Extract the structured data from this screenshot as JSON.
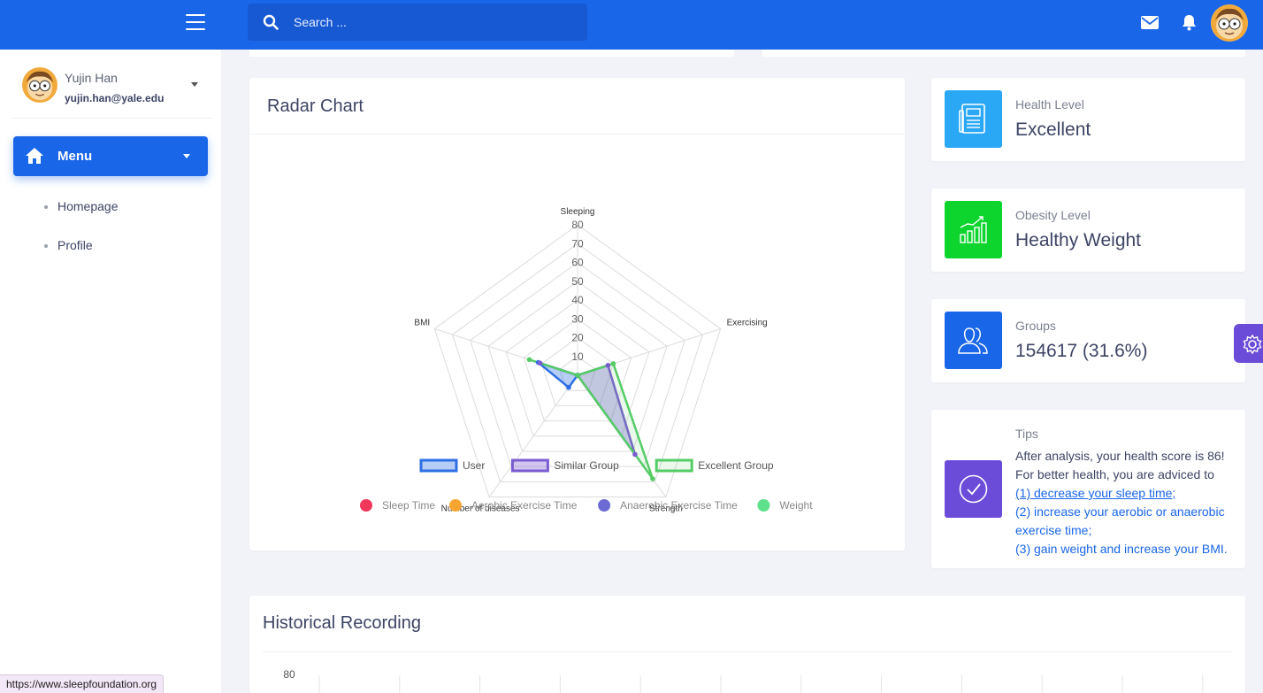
{
  "header": {
    "search_placeholder": "Search ...",
    "icons": [
      "menu-icon",
      "search-icon",
      "mail-icon",
      "bell-icon",
      "avatar"
    ],
    "accent": "#1a66e8"
  },
  "sidebar": {
    "user_name": "Yujin Han",
    "user_email": "yujin.han@yale.edu",
    "menu_label": "Menu",
    "items": [
      {
        "label": "Homepage"
      },
      {
        "label": "Profile"
      }
    ]
  },
  "radar": {
    "title": "Radar Chart",
    "chart_data": {
      "type": "radar",
      "axes": [
        "Sleeping",
        "Exercising",
        "Strength",
        "Number of diseases",
        "BMI"
      ],
      "rlim": [
        0,
        80
      ],
      "ticks": [
        10,
        20,
        30,
        40,
        50,
        60,
        70,
        80
      ],
      "tick_labels": [
        "10",
        "20",
        "30",
        "40",
        "50",
        "60",
        "70",
        "80"
      ],
      "series": [
        {
          "name": "User",
          "color": "#2f6fe4",
          "values": [
            0,
            0,
            0,
            8,
            22
          ]
        },
        {
          "name": "Similar Group",
          "color": "#7a5cd0",
          "values": [
            0,
            17,
            52,
            0,
            21
          ]
        },
        {
          "name": "Excellent Group",
          "color": "#55cc66",
          "values": [
            0,
            20,
            68,
            0,
            27
          ]
        }
      ],
      "secondary_legend": [
        {
          "name": "Sleep Time",
          "color": "#f2385a"
        },
        {
          "name": "Aerobic Exercise Time",
          "color": "#f7a531"
        },
        {
          "name": "Anaerobic Exercise Time",
          "color": "#6c6bd4"
        },
        {
          "name": "Weight",
          "color": "#5fe08a"
        }
      ],
      "grid": true
    }
  },
  "stats": [
    {
      "label": "Health Level",
      "value": "Excellent",
      "color": "#2aa8f5",
      "icon": "newspaper-icon"
    },
    {
      "label": "Obesity Level",
      "value": "Healthy Weight",
      "color": "#0ed52e",
      "icon": "bar-chart-icon"
    },
    {
      "label": "Groups",
      "value": "154617 (31.6%)",
      "color": "#1a66e8",
      "icon": "users-icon"
    }
  ],
  "tips": {
    "label": "Tips",
    "color": "#6a4cd9",
    "icon": "check-circle-icon",
    "line1": "After analysis, your health score is 86!",
    "line2": "For better health, you are adviced to",
    "link1": "(1) decrease your sleep time;",
    "link2": "(2) increase your aerobic or anaerobic exercise time;",
    "link3": "(3) gain weight and increase your BMI."
  },
  "history": {
    "title": "Historical Recording",
    "y_tick_top": "80"
  },
  "status_url": "https://www.sleepfoundation.org"
}
